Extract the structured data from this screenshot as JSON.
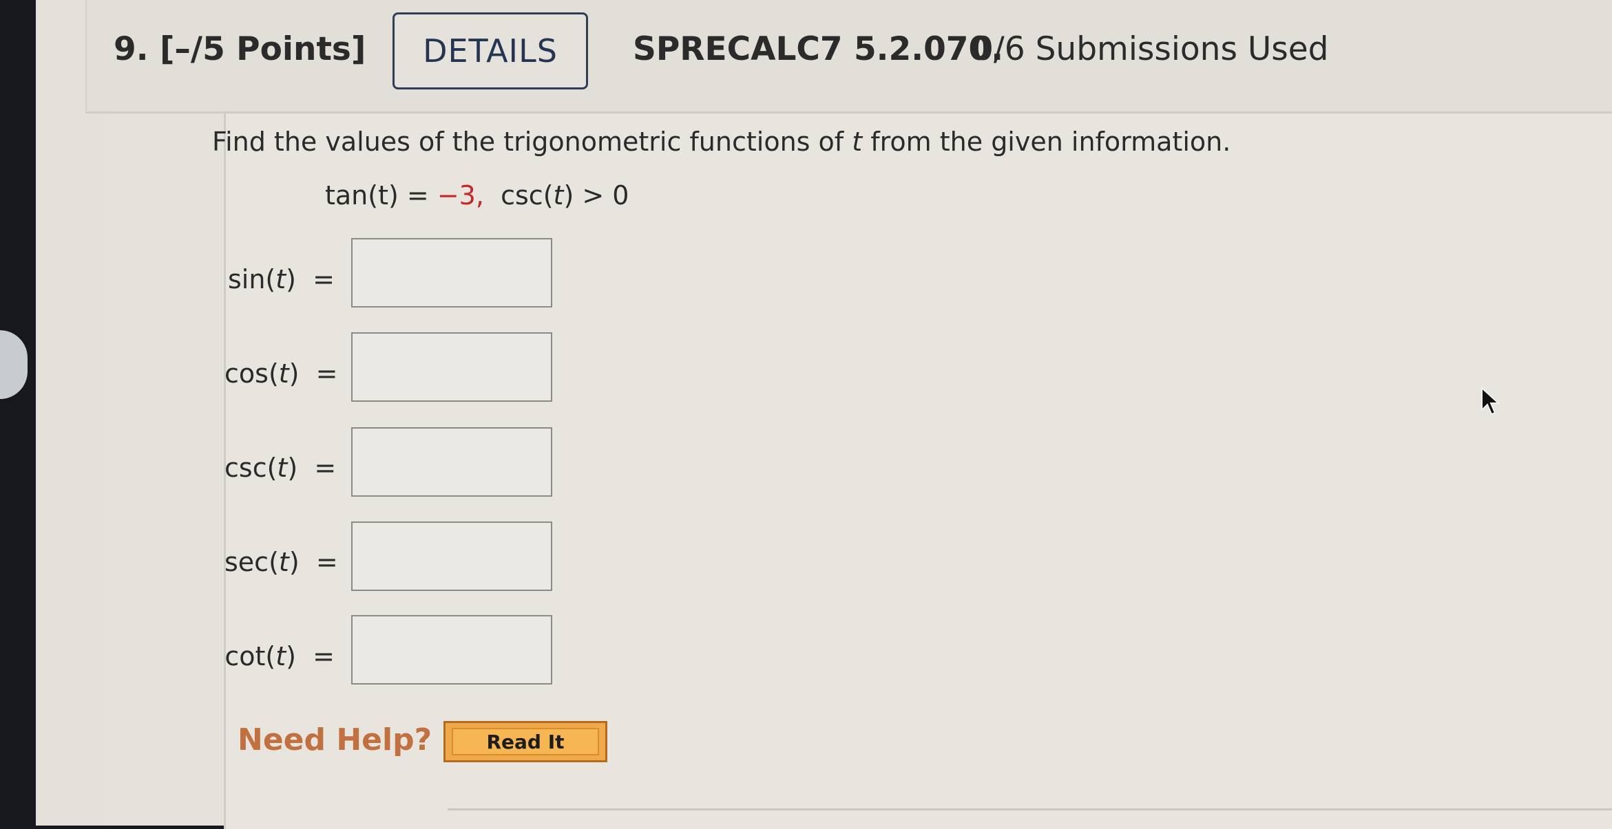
{
  "header": {
    "question_number": "9.",
    "points": "[–/5 Points]",
    "details_label": "DETAILS",
    "problem_code": "SPRECALC7 5.2.070.",
    "submissions": "0/6 Submissions Used"
  },
  "question": {
    "instruction_pre": "Find the values of the trigonometric functions of ",
    "instruction_var": "t",
    "instruction_post": " from the given information.",
    "given": {
      "tan_prefix": "tan(t) = ",
      "tan_value": "−3,",
      "csc_condition_fn": "csc(",
      "csc_condition_var": "t",
      "csc_condition_rest": ") > 0"
    },
    "rows": [
      {
        "fn": "sin(",
        "var": "t",
        "close": ")",
        "equals": "=",
        "value": ""
      },
      {
        "fn": "cos(",
        "var": "t",
        "close": ")",
        "equals": "=",
        "value": ""
      },
      {
        "fn": "csc(",
        "var": "t",
        "close": ")",
        "equals": "=",
        "value": ""
      },
      {
        "fn": "sec(",
        "var": "t",
        "close": ")",
        "equals": "=",
        "value": ""
      },
      {
        "fn": "cot(",
        "var": "t",
        "close": ")",
        "equals": "=",
        "value": ""
      }
    ]
  },
  "help": {
    "label": "Need Help?",
    "read_it_label": "Read It"
  },
  "colors": {
    "accent_red": "#c62828",
    "need_help_orange": "#c2703f",
    "read_it_fill": "#f6b654"
  },
  "icons": {
    "cursor": "mouse-pointer-icon"
  }
}
